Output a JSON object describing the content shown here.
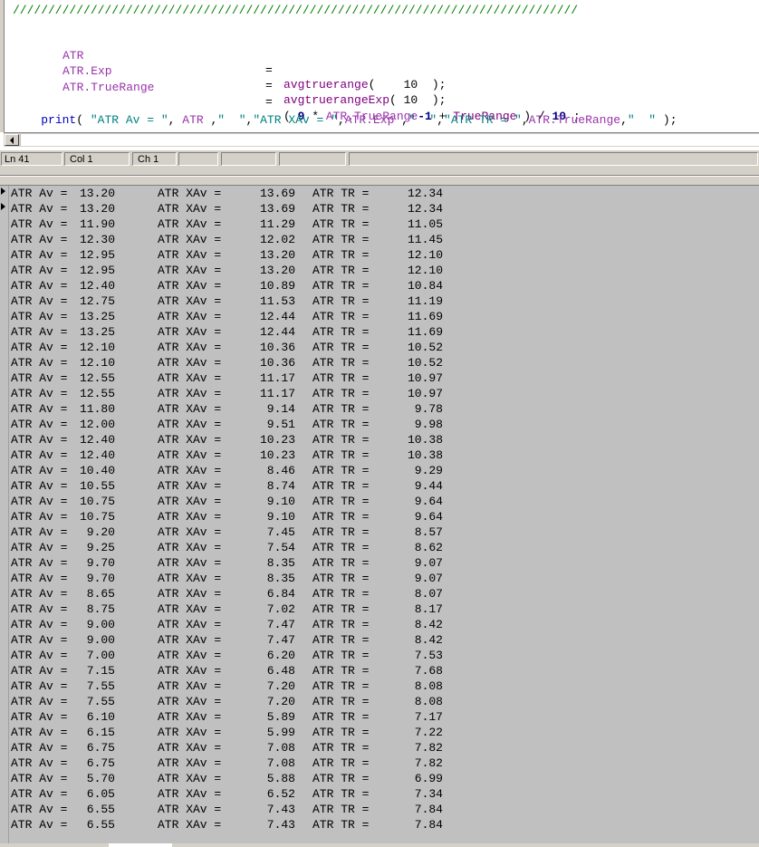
{
  "editor": {
    "separator": "////////////////////////////////////////////////////////////////////////////////",
    "assignments": [
      {
        "target": "ATR",
        "op": "=",
        "func": "avgtruerange",
        "args": "(    10  );"
      },
      {
        "target": "ATR.Exp",
        "op": "=",
        "func": "avgtruerangeExp",
        "args": "( 10  );"
      }
    ],
    "truerange_line": {
      "target": "ATR.TrueRange",
      "op": "=",
      "open": "( ",
      "nine": "9",
      "mul": " * ",
      "ref": "ATR.TrueRange",
      "minus_one": "-1",
      "plus": " + ",
      "tr": "TrueRange",
      "close": " ) / ",
      "ten": "10",
      "end": " ;"
    },
    "print_line": {
      "kw": "print",
      "open": "( ",
      "s1": "\"ATR Av = \"",
      "c1": ", ",
      "v1": "ATR",
      "c2": " ,",
      "s2": "\"  \"",
      "c3": ",",
      "s3": "\"ATR XAv = \"",
      "c4": ",",
      "v2": "ATR.Exp",
      "c5": " ,",
      "s4": "\"  \"",
      "c6": ",",
      "s5": "\"ATR TR = \"",
      "c7": ",",
      "v3": "ATR.TrueRange",
      "c8": ",",
      "s6": "\"  \"",
      "close": " );"
    }
  },
  "statusbar": {
    "line": "Ln 41",
    "col": "Col 1",
    "ch": "Ch 1"
  },
  "output": {
    "labels": {
      "av": "ATR Av =",
      "xav": "ATR XAv =",
      "tr": "ATR TR ="
    },
    "rows": [
      [
        "13.20",
        "13.69",
        "12.34"
      ],
      [
        "13.20",
        "13.69",
        "12.34"
      ],
      [
        "11.90",
        "11.29",
        "11.05"
      ],
      [
        "12.30",
        "12.02",
        "11.45"
      ],
      [
        "12.95",
        "13.20",
        "12.10"
      ],
      [
        "12.95",
        "13.20",
        "12.10"
      ],
      [
        "12.40",
        "10.89",
        "10.84"
      ],
      [
        "12.75",
        "11.53",
        "11.19"
      ],
      [
        "13.25",
        "12.44",
        "11.69"
      ],
      [
        "13.25",
        "12.44",
        "11.69"
      ],
      [
        "12.10",
        "10.36",
        "10.52"
      ],
      [
        "12.10",
        "10.36",
        "10.52"
      ],
      [
        "12.55",
        "11.17",
        "10.97"
      ],
      [
        "12.55",
        "11.17",
        "10.97"
      ],
      [
        "11.80",
        "9.14",
        "9.78"
      ],
      [
        "12.00",
        "9.51",
        "9.98"
      ],
      [
        "12.40",
        "10.23",
        "10.38"
      ],
      [
        "12.40",
        "10.23",
        "10.38"
      ],
      [
        "10.40",
        "8.46",
        "9.29"
      ],
      [
        "10.55",
        "8.74",
        "9.44"
      ],
      [
        "10.75",
        "9.10",
        "9.64"
      ],
      [
        "10.75",
        "9.10",
        "9.64"
      ],
      [
        "9.20",
        "7.45",
        "8.57"
      ],
      [
        "9.25",
        "7.54",
        "8.62"
      ],
      [
        "9.70",
        "8.35",
        "9.07"
      ],
      [
        "9.70",
        "8.35",
        "9.07"
      ],
      [
        "8.65",
        "6.84",
        "8.07"
      ],
      [
        "8.75",
        "7.02",
        "8.17"
      ],
      [
        "9.00",
        "7.47",
        "8.42"
      ],
      [
        "9.00",
        "7.47",
        "8.42"
      ],
      [
        "7.00",
        "6.20",
        "7.53"
      ],
      [
        "7.15",
        "6.48",
        "7.68"
      ],
      [
        "7.55",
        "7.20",
        "8.08"
      ],
      [
        "7.55",
        "7.20",
        "8.08"
      ],
      [
        "6.10",
        "5.89",
        "7.17"
      ],
      [
        "6.15",
        "5.99",
        "7.22"
      ],
      [
        "6.75",
        "7.08",
        "7.82"
      ],
      [
        "6.75",
        "7.08",
        "7.82"
      ],
      [
        "5.70",
        "5.88",
        "6.99"
      ],
      [
        "6.05",
        "6.52",
        "7.34"
      ],
      [
        "6.55",
        "7.43",
        "7.84"
      ],
      [
        "6.55",
        "7.43",
        "7.84"
      ]
    ]
  }
}
